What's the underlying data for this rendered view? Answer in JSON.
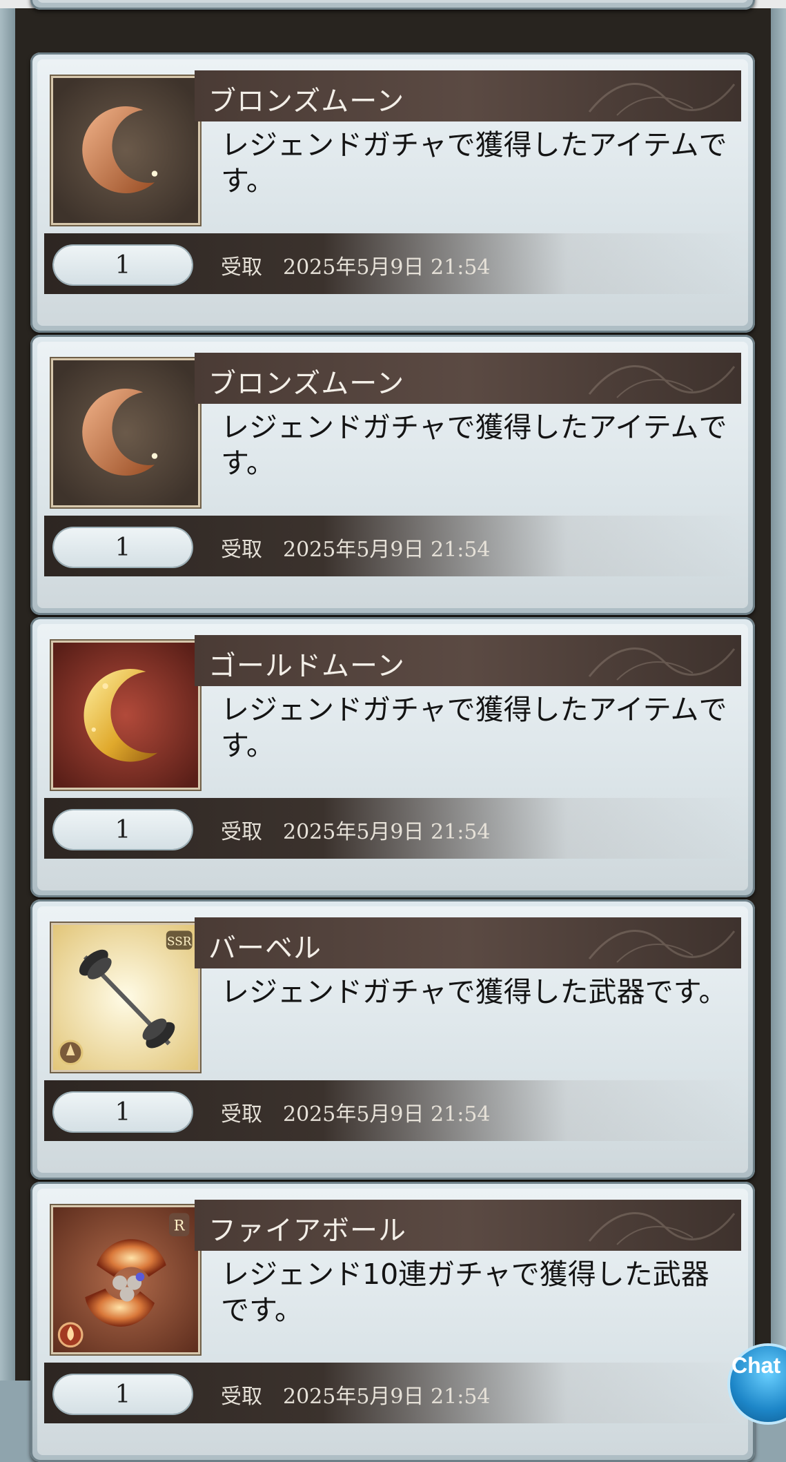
{
  "items": [
    {
      "name": "ブロンズムーン",
      "description": "レジェンドガチャで獲得したアイテムです。",
      "quantity": "1",
      "status": "受取",
      "timestamp": "2025年5月9日 21:54",
      "icon": "bronze-moon-icon"
    },
    {
      "name": "ブロンズムーン",
      "description": "レジェンドガチャで獲得したアイテムです。",
      "quantity": "1",
      "status": "受取",
      "timestamp": "2025年5月9日 21:54",
      "icon": "bronze-moon-icon"
    },
    {
      "name": "ゴールドムーン",
      "description": "レジェンドガチャで獲得したアイテムです。",
      "quantity": "1",
      "status": "受取",
      "timestamp": "2025年5月9日 21:54",
      "icon": "gold-moon-icon"
    },
    {
      "name": "バーベル",
      "description": "レジェンドガチャで獲得した武器です。",
      "quantity": "1",
      "status": "受取",
      "timestamp": "2025年5月9日 21:54",
      "icon": "barbell-weapon-icon",
      "rarity": "SSR"
    },
    {
      "name": "ファイアボール",
      "description": "レジェンド10連ガチャで獲得した武器です。",
      "quantity": "1",
      "status": "受取",
      "timestamp": "2025年5月9日 21:54",
      "icon": "fireball-weapon-icon",
      "rarity": "R"
    }
  ],
  "chat_button": {
    "label": "Chat"
  }
}
